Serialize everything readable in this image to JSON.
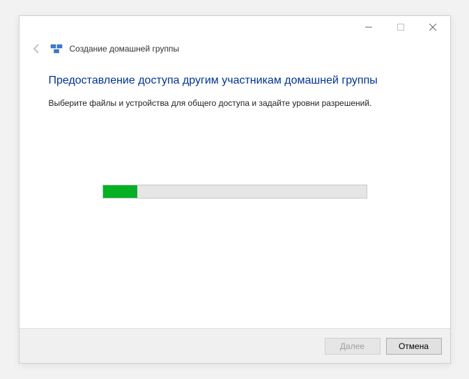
{
  "window": {
    "title": "Создание домашней группы"
  },
  "content": {
    "heading": "Предоставление доступа другим участникам домашней группы",
    "subtext": "Выберите файлы и устройства для общего доступа и задайте уровни разрешений."
  },
  "progress": {
    "percent": 13
  },
  "footer": {
    "next_label": "Далее",
    "cancel_label": "Отмена"
  }
}
